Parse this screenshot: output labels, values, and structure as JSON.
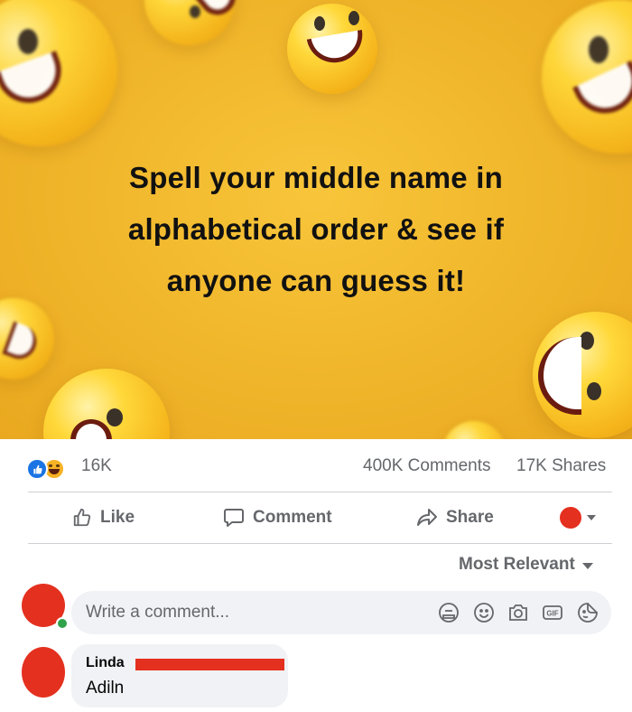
{
  "post_image": {
    "lines": [
      "Spell your middle name in",
      "alphabetical order & see if",
      "anyone can guess it!"
    ]
  },
  "stats": {
    "reactions_count": "16K",
    "comments": "400K Comments",
    "shares": "17K Shares",
    "reaction_icons": [
      "like-icon",
      "haha-icon"
    ]
  },
  "actions": {
    "like": "Like",
    "comment": "Comment",
    "share": "Share"
  },
  "sort": {
    "label": "Most Relevant"
  },
  "composer": {
    "placeholder": "Write a comment...",
    "icons": [
      "avatar-sticker-icon",
      "emoji-icon",
      "camera-icon",
      "gif-icon",
      "sticker-icon"
    ]
  },
  "comments": [
    {
      "author": "Linda",
      "text": "Adiln"
    }
  ],
  "colors": {
    "background_yellow": "#f0b52a",
    "accent_blue": "#1b74e4",
    "redaction_red": "#e4301f",
    "muted_text": "#65676b",
    "bubble_bg": "#f0f2f5"
  }
}
